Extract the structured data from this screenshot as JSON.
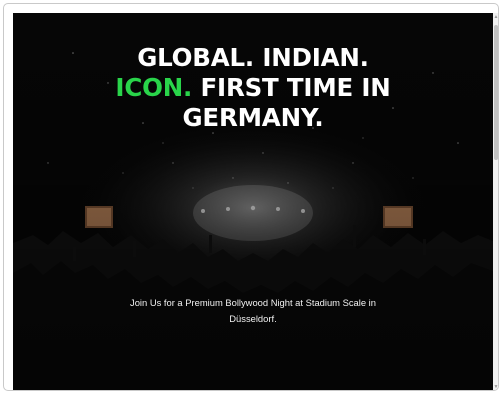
{
  "hero": {
    "headline_line1": "GLOBAL. INDIAN.",
    "headline_accent": "ICON.",
    "headline_line2_rest": " FIRST TIME IN",
    "headline_line3": "GERMANY.",
    "tagline_line1": "Join Us for a Premium Bollywood Night at Stadium Scale in",
    "tagline_line2": "Düsseldorf."
  },
  "colors": {
    "accent": "#29d44a",
    "background": "#050505",
    "text": "#ffffff"
  },
  "scrollbar": {
    "up_icon": "scroll-up-arrow-icon",
    "down_icon": "scroll-down-arrow-icon"
  }
}
